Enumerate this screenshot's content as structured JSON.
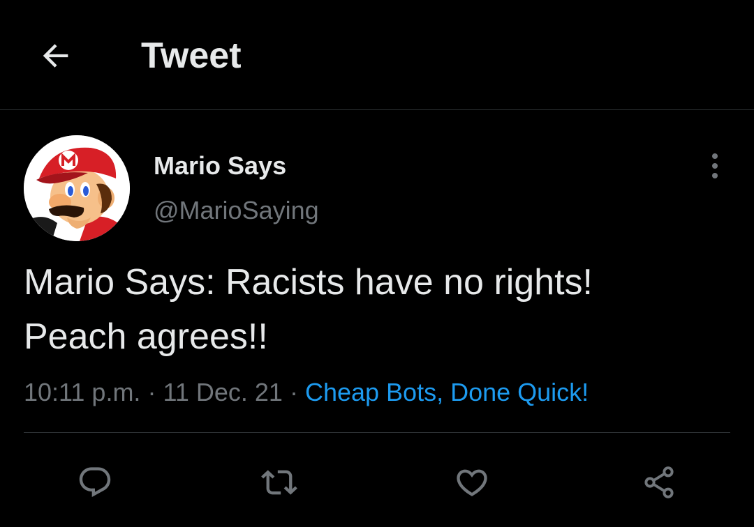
{
  "header": {
    "title": "Tweet",
    "back_icon": "arrow-left-icon"
  },
  "tweet": {
    "author_name": "Mario Says",
    "author_handle": "@MarioSaying",
    "avatar_icon": "mario-avatar",
    "text": "Mario Says: Racists have no rights!\nPeach agrees!!",
    "time": "10:11 p.m.",
    "date": "11 Dec. 21",
    "separator": "·",
    "source": "Cheap Bots, Done Quick!"
  },
  "actions": [
    {
      "icon": "reply-icon"
    },
    {
      "icon": "retweet-icon"
    },
    {
      "icon": "like-icon"
    },
    {
      "icon": "share-icon"
    }
  ],
  "colors": {
    "background": "#000000",
    "text_primary": "#e7e9ea",
    "text_secondary": "#71767b",
    "accent": "#1d9bf0",
    "divider": "#2f3336"
  }
}
